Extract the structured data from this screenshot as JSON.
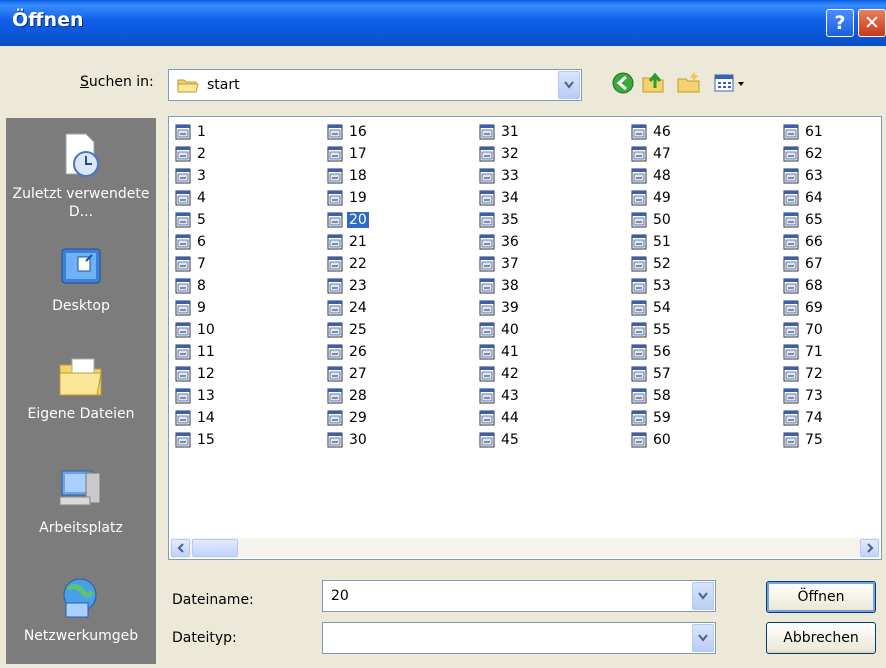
{
  "window": {
    "title": "Öffnen"
  },
  "titlebar": {
    "help_label": "?",
    "close_label": "✕"
  },
  "lookin": {
    "label": "Suchen in:",
    "value": "start"
  },
  "places": [
    {
      "label": "Zuletzt verwendete D...",
      "icon": "recent-documents-icon"
    },
    {
      "label": "Desktop",
      "icon": "desktop-icon"
    },
    {
      "label": "Eigene Dateien",
      "icon": "my-documents-icon"
    },
    {
      "label": "Arbeitsplatz",
      "icon": "my-computer-icon"
    },
    {
      "label": "Netzwerkumgeb",
      "icon": "network-icon"
    }
  ],
  "files": {
    "columns": [
      [
        "1",
        "2",
        "3",
        "4",
        "5",
        "6",
        "7",
        "8",
        "9",
        "10",
        "11",
        "12",
        "13",
        "14",
        "15"
      ],
      [
        "16",
        "17",
        "18",
        "19",
        "20",
        "21",
        "22",
        "23",
        "24",
        "25",
        "26",
        "27",
        "28",
        "29",
        "30"
      ],
      [
        "31",
        "32",
        "33",
        "34",
        "35",
        "36",
        "37",
        "38",
        "39",
        "40",
        "41",
        "42",
        "43",
        "44",
        "45"
      ],
      [
        "46",
        "47",
        "48",
        "49",
        "50",
        "51",
        "52",
        "53",
        "54",
        "55",
        "56",
        "57",
        "58",
        "59",
        "60"
      ],
      [
        "61",
        "62",
        "63",
        "64",
        "65",
        "66",
        "67",
        "68",
        "69",
        "70",
        "71",
        "72",
        "73",
        "74",
        "75"
      ]
    ],
    "selected": "20"
  },
  "filename": {
    "label": "Dateiname:",
    "value": "20"
  },
  "filetype": {
    "label": "Dateityp:",
    "value": ""
  },
  "buttons": {
    "open": "Öffnen",
    "cancel": "Abbrechen"
  },
  "colors": {
    "titlebar": "#0b56d6",
    "selection": "#316ac5",
    "places_bg": "#7c7c7c"
  }
}
